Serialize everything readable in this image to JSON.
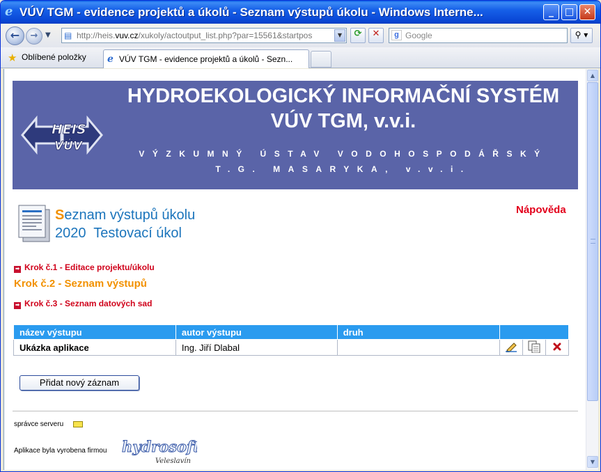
{
  "window": {
    "title": "VÚV TGM - evidence projektů a úkolů - Seznam výstupů úkolu - Windows Interne...",
    "minimize": "_",
    "maximize": "□",
    "close": "✕"
  },
  "nav": {
    "back_icon": "←",
    "forward_icon": "→",
    "dropdown_icon": "▼",
    "address_prefix": "http://heis.",
    "address_host": "vuv.cz",
    "address_rest": "/xukoly/actoutput_list.php?par=15561&startpos",
    "refresh_icon": "⟳",
    "stop_icon": "✕",
    "search_placeholder": "Google",
    "search_icon": "⚲ ▾"
  },
  "favorites": {
    "label": "Oblíbené položky",
    "tab_title": "VÚV TGM - evidence projektů a úkolů - Sezn..."
  },
  "banner": {
    "title": "HYDROEKOLOGICKÝ INFORMAČNÍ SYSTÉM VÚV TGM, v.v.i.",
    "subtitle": "VÝZKUMNÝ ÚSTAV VODOHOSPODÁŘSKÝ T.G. MASARYKA, v.v.i.",
    "logo_text": "HEIS VÚV"
  },
  "page": {
    "title_first_letter": "S",
    "title_rest": "eznam výstupů úkolu",
    "task_number": "2020",
    "task_name": "Testovací úkol",
    "help_link": "Nápověda"
  },
  "steps": {
    "step1": "Krok č.1 - Editace projektu/úkolu",
    "step2": "Krok č.2 - Seznam výstupů",
    "step3": "Krok č.3 - Seznam datových sad"
  },
  "table": {
    "headers": [
      "název výstupu",
      "autor výstupu",
      "druh"
    ],
    "rows": [
      {
        "name": "Ukázka aplikace",
        "author": "Ing. Jiří Dlabal",
        "kind": ""
      }
    ]
  },
  "actions": {
    "add_button": "Přidat nový záznam"
  },
  "footer": {
    "admin": "správce serveru",
    "maker": "Aplikace byla vyrobena firmou",
    "company": "hydrosoft",
    "company_place": "Veleslavín"
  }
}
